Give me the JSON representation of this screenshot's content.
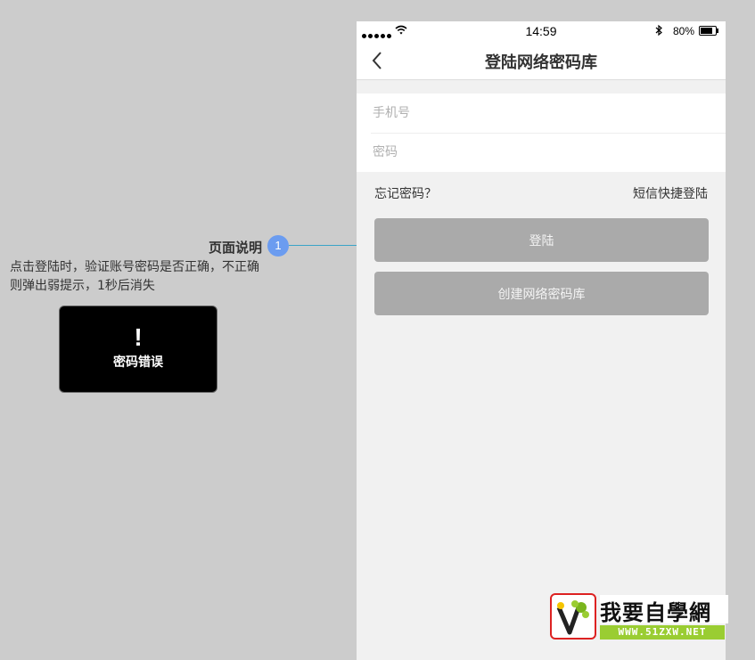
{
  "annotation": {
    "title": "页面说明",
    "badge": "1",
    "description": "点击登陆时，验证账号密码是否正确，不正确则弹出弱提示，1秒后消失",
    "toast": {
      "icon": "!",
      "text": "密码错误"
    }
  },
  "statusbar": {
    "time": "14:59",
    "battery": "80%",
    "battery_level": 0.8
  },
  "navbar": {
    "title": "登陆网络密码库",
    "back_icon": "chevron-left-icon"
  },
  "form": {
    "phone_placeholder": "手机号",
    "password_placeholder": "密码"
  },
  "links": {
    "forgot": "忘记密码？",
    "sms_login": "短信快捷登陆"
  },
  "buttons": {
    "login": "登陆",
    "create": "创建网络密码库"
  },
  "watermark": {
    "name": "我要自學網",
    "url": "WWW.51ZXW.NET"
  },
  "colors": {
    "background": "#cccccc",
    "badge": "#6b9cf0",
    "button": "#aaaaaa",
    "toast": "#000000"
  }
}
